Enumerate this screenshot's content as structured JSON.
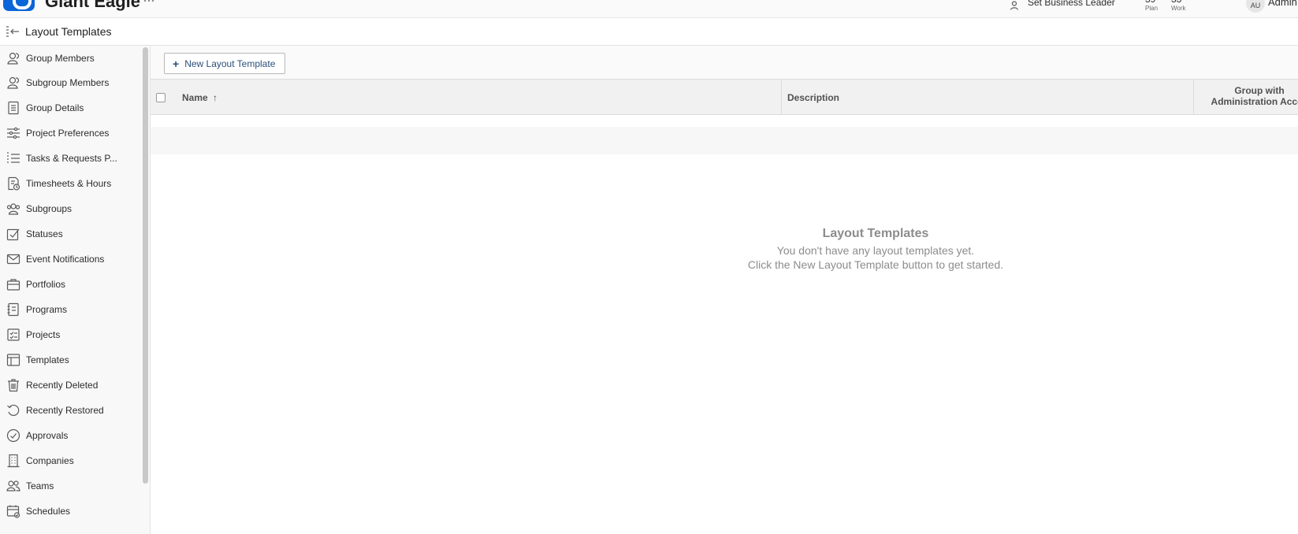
{
  "topbar": {
    "org_name": "Giant Eagle",
    "business_leader": "Set Business Leader",
    "metrics": [
      {
        "num": "39",
        "caption": "Plan"
      },
      {
        "num": "33",
        "caption": "Work"
      }
    ],
    "avatar_initials": "AU",
    "user_name": "Admin"
  },
  "header": {
    "title": "Layout Templates"
  },
  "sidebar": {
    "items": [
      {
        "label": "Group Members",
        "icon": "users-icon"
      },
      {
        "label": "Subgroup Members",
        "icon": "users-icon"
      },
      {
        "label": "Group Details",
        "icon": "document-icon"
      },
      {
        "label": "Project Preferences",
        "icon": "sliders-icon"
      },
      {
        "label": "Tasks & Requests P...",
        "icon": "list-icon"
      },
      {
        "label": "Timesheets & Hours",
        "icon": "timesheet-icon"
      },
      {
        "label": "Subgroups",
        "icon": "group-icon"
      },
      {
        "label": "Statuses",
        "icon": "checkbox-icon"
      },
      {
        "label": "Event Notifications",
        "icon": "mail-icon"
      },
      {
        "label": "Portfolios",
        "icon": "briefcase-icon"
      },
      {
        "label": "Programs",
        "icon": "program-icon"
      },
      {
        "label": "Projects",
        "icon": "project-icon"
      },
      {
        "label": "Templates",
        "icon": "template-icon"
      },
      {
        "label": "Recently Deleted",
        "icon": "trash-icon"
      },
      {
        "label": "Recently Restored",
        "icon": "restore-icon"
      },
      {
        "label": "Approvals",
        "icon": "approval-icon"
      },
      {
        "label": "Companies",
        "icon": "building-icon"
      },
      {
        "label": "Teams",
        "icon": "team-icon"
      },
      {
        "label": "Schedules",
        "icon": "calendar-icon"
      }
    ]
  },
  "toolbar": {
    "new_button": "New Layout Template"
  },
  "table": {
    "columns": [
      "Name",
      "Description",
      "Group with Administration Acces"
    ],
    "sort_indicator": "↑"
  },
  "empty_state": {
    "title": "Layout Templates",
    "line1": "You don't have any layout templates yet.",
    "line2": "Click the New Layout Template button to get started."
  },
  "colors": {
    "accent": "#0a66d8",
    "button_text": "#2b4f7a",
    "muted_text": "#8c8c8c"
  }
}
